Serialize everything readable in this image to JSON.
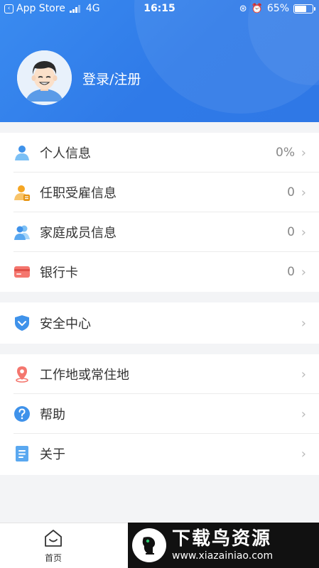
{
  "status_bar": {
    "back_app": "App Store",
    "network": "4G",
    "time": "16:15",
    "battery": "65%",
    "battery_level": 0.65
  },
  "profile": {
    "login_label": "登录/注册",
    "avatar_icon": "user-avatar-icon"
  },
  "groups": [
    {
      "rows": [
        {
          "label": "个人信息",
          "value": "0%",
          "icon": "person-icon"
        },
        {
          "label": "任职受雇信息",
          "value": "0",
          "icon": "employee-icon"
        },
        {
          "label": "家庭成员信息",
          "value": "0",
          "icon": "family-icon"
        },
        {
          "label": "银行卡",
          "value": "0",
          "icon": "bank-card-icon"
        }
      ]
    },
    {
      "rows": [
        {
          "label": "安全中心",
          "value": "",
          "icon": "shield-icon"
        }
      ]
    },
    {
      "rows": [
        {
          "label": "工作地或常住地",
          "value": "",
          "icon": "location-pin-icon"
        },
        {
          "label": "帮助",
          "value": "",
          "icon": "help-icon"
        },
        {
          "label": "关于",
          "value": "",
          "icon": "document-icon"
        }
      ]
    }
  ],
  "tab_bar": {
    "home_label": "首页",
    "home_icon": "home-icon"
  },
  "watermark": {
    "title": "下载鸟资源",
    "url": "www.xiazainiao.com"
  },
  "colors": {
    "header_blue": "#2f7ae8",
    "background": "#f3f4f6",
    "chevron": "#b8b8b8"
  }
}
